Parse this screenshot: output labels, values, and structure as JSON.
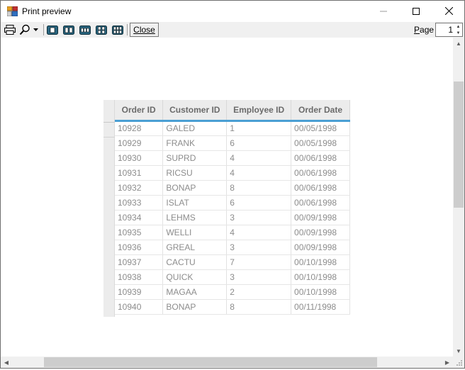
{
  "window": {
    "title": "Print preview",
    "icons": {
      "app": "print-preview-app-icon",
      "minimize": "minimize-icon",
      "maximize": "maximize-icon",
      "close": "close-icon"
    }
  },
  "toolbar": {
    "close_label": "Close",
    "page_label": "Page",
    "page_value": "1",
    "icons": [
      "printer-icon",
      "zoom-icon",
      "chevron-down-icon",
      "one-page-icon",
      "two-pages-icon",
      "three-pages-icon",
      "four-pages-icon",
      "six-pages-icon"
    ]
  },
  "grid": {
    "columns": [
      "Order ID",
      "Customer ID",
      "Employee ID",
      "Order Date"
    ],
    "rows": [
      [
        "10928",
        "GALED",
        "1",
        "00/05/1998"
      ],
      [
        "10929",
        "FRANK",
        "6",
        "00/05/1998"
      ],
      [
        "10930",
        "SUPRD",
        "4",
        "00/06/1998"
      ],
      [
        "10931",
        "RICSU",
        "4",
        "00/06/1998"
      ],
      [
        "10932",
        "BONAP",
        "8",
        "00/06/1998"
      ],
      [
        "10933",
        "ISLAT",
        "6",
        "00/06/1998"
      ],
      [
        "10934",
        "LEHMS",
        "3",
        "00/09/1998"
      ],
      [
        "10935",
        "WELLI",
        "4",
        "00/09/1998"
      ],
      [
        "10936",
        "GREAL",
        "3",
        "00/09/1998"
      ],
      [
        "10937",
        "CACTU",
        "7",
        "00/10/1998"
      ],
      [
        "10938",
        "QUICK",
        "3",
        "00/10/1998"
      ],
      [
        "10939",
        "MAGAA",
        "2",
        "00/10/1998"
      ],
      [
        "10940",
        "BONAP",
        "8",
        "00/11/1998"
      ]
    ]
  },
  "colors": {
    "header_accent": "#4a9fd4",
    "header_bg": "#ececec",
    "cell_text": "#8c8c8c"
  }
}
